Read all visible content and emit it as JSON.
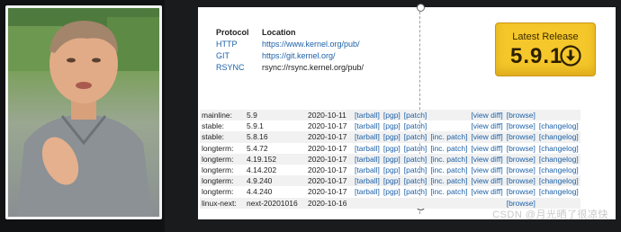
{
  "protocols": {
    "header_protocol": "Protocol",
    "header_location": "Location",
    "rows": [
      {
        "name": "HTTP",
        "location": "https://www.kernel.org/pub/",
        "linked": true
      },
      {
        "name": "GIT",
        "location": "https://git.kernel.org/",
        "linked": true
      },
      {
        "name": "RSYNC",
        "location": "rsync://rsync.kernel.org/pub/",
        "linked": false
      }
    ]
  },
  "latest_release": {
    "label": "Latest Release",
    "version": "5.9.1",
    "icon": "download-arrow-icon",
    "color": "#f5c72a"
  },
  "releases": [
    {
      "kind": "mainline:",
      "version": "5.9",
      "date": "2020-10-11",
      "tarball": "[tarball]",
      "pgp": "[pgp]",
      "patch": "[patch]",
      "inc_patch": "",
      "view_diff": "[view diff]",
      "browse": "[browse]",
      "changelog": ""
    },
    {
      "kind": "stable:",
      "version": "5.9.1",
      "date": "2020-10-17",
      "tarball": "[tarball]",
      "pgp": "[pgp]",
      "patch": "[patch]",
      "inc_patch": "",
      "view_diff": "[view diff]",
      "browse": "[browse]",
      "changelog": "[changelog]"
    },
    {
      "kind": "stable:",
      "version": "5.8.16",
      "date": "2020-10-17",
      "tarball": "[tarball]",
      "pgp": "[pgp]",
      "patch": "[patch]",
      "inc_patch": "[inc. patch]",
      "view_diff": "[view diff]",
      "browse": "[browse]",
      "changelog": "[changelog]"
    },
    {
      "kind": "longterm:",
      "version": "5.4.72",
      "date": "2020-10-17",
      "tarball": "[tarball]",
      "pgp": "[pgp]",
      "patch": "[patch]",
      "inc_patch": "[inc. patch]",
      "view_diff": "[view diff]",
      "browse": "[browse]",
      "changelog": "[changelog]"
    },
    {
      "kind": "longterm:",
      "version": "4.19.152",
      "date": "2020-10-17",
      "tarball": "[tarball]",
      "pgp": "[pgp]",
      "patch": "[patch]",
      "inc_patch": "[inc. patch]",
      "view_diff": "[view diff]",
      "browse": "[browse]",
      "changelog": "[changelog]"
    },
    {
      "kind": "longterm:",
      "version": "4.14.202",
      "date": "2020-10-17",
      "tarball": "[tarball]",
      "pgp": "[pgp]",
      "patch": "[patch]",
      "inc_patch": "[inc. patch]",
      "view_diff": "[view diff]",
      "browse": "[browse]",
      "changelog": "[changelog]"
    },
    {
      "kind": "longterm:",
      "version": "4.9.240",
      "date": "2020-10-17",
      "tarball": "[tarball]",
      "pgp": "[pgp]",
      "patch": "[patch]",
      "inc_patch": "[inc. patch]",
      "view_diff": "[view diff]",
      "browse": "[browse]",
      "changelog": "[changelog]"
    },
    {
      "kind": "longterm:",
      "version": "4.4.240",
      "date": "2020-10-17",
      "tarball": "[tarball]",
      "pgp": "[pgp]",
      "patch": "[patch]",
      "inc_patch": "[inc. patch]",
      "view_diff": "[view diff]",
      "browse": "[browse]",
      "changelog": "[changelog]"
    },
    {
      "kind": "linux-next:",
      "version": "next-20201016",
      "date": "2020-10-16",
      "tarball": "",
      "pgp": "",
      "patch": "",
      "inc_patch": "",
      "view_diff": "",
      "browse": "[browse]",
      "changelog": ""
    }
  ],
  "watermark": "CSDN @月光晒了很凉快",
  "colors": {
    "link": "#1d61a8",
    "background": "#1a1b1d"
  }
}
